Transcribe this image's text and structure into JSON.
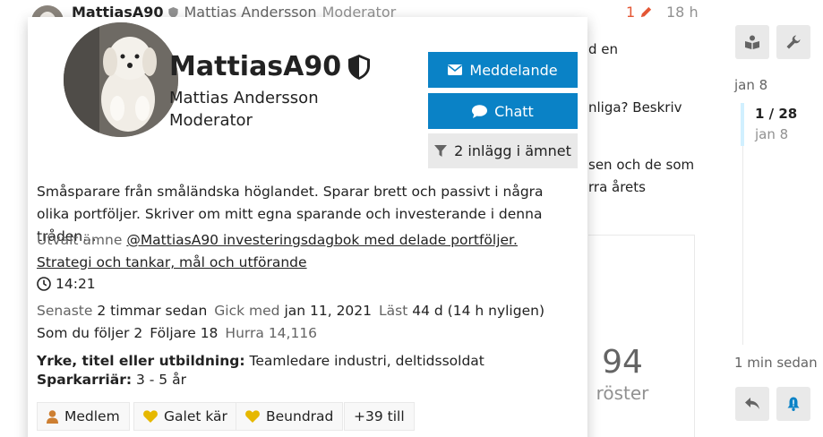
{
  "post": {
    "username": "MattiasA90",
    "full_name": "Mattias Andersson",
    "role": "Moderator",
    "edit_count": "1",
    "time": "18 h",
    "text_fragments": [
      "d en",
      "nliga? Beskriv",
      "sen och de som",
      "rra årets"
    ]
  },
  "poll": {
    "votes": "94",
    "votes_label": "röster"
  },
  "timeline": {
    "start_date": "jan 8",
    "position": "1 / 28",
    "position_date": "jan 8",
    "last_activity": "1 min sedan"
  },
  "sidebar_icons": [
    "book-icon",
    "wrench-icon",
    "reply-icon",
    "bell-icon"
  ],
  "user_card": {
    "username": "MattiasA90",
    "full_name": "Mattias Andersson",
    "title": "Moderator",
    "message_button": "Meddelande",
    "chat_button": "Chatt",
    "filter_button": "2 inlägg i ämnet",
    "bio": "Småsparare från småländska höglandet. Sparar brett och passivt i några olika portföljer. Skriver om mitt egna sparande och investerande i denna tråden…",
    "featured_label": "Utvalt ämne",
    "featured_topic": "@MattiasA90 investeringsdagbok med delade portföljer. Strategi och tankar, mål och utförande",
    "local_time": "14:21",
    "stats": {
      "last_post_label": "Senaste",
      "last_post_value": "2 timmar sedan",
      "joined_label": "Gick med",
      "joined_value": "jan 11, 2021",
      "read_label": "Läst",
      "read_value": "44 d (14 h nyligen)",
      "following_label": "Som du följer",
      "following_value": "2",
      "followers_label": "Följare",
      "followers_value": "18",
      "cheers_label": "Hurra",
      "cheers_value": "14,116"
    },
    "fields": [
      {
        "label": "Yrke, titel eller utbildning:",
        "value": "Teamledare industri, deltidssoldat"
      },
      {
        "label": "Sparkarriär:",
        "value": "3 - 5 år"
      }
    ],
    "badges": [
      {
        "label": "Medlem",
        "icon": "user-icon"
      },
      {
        "label": "Galet kär",
        "icon": "heart-icon"
      },
      {
        "label": "Beundrad",
        "icon": "heart-icon"
      }
    ],
    "more_badges": "+39 till"
  },
  "colors": {
    "primary": "#0a82c6",
    "edit": "#e45735",
    "bronze": "#cd7f32",
    "heart": "#e6b800",
    "timeline_bar": "#d1f0ff"
  }
}
